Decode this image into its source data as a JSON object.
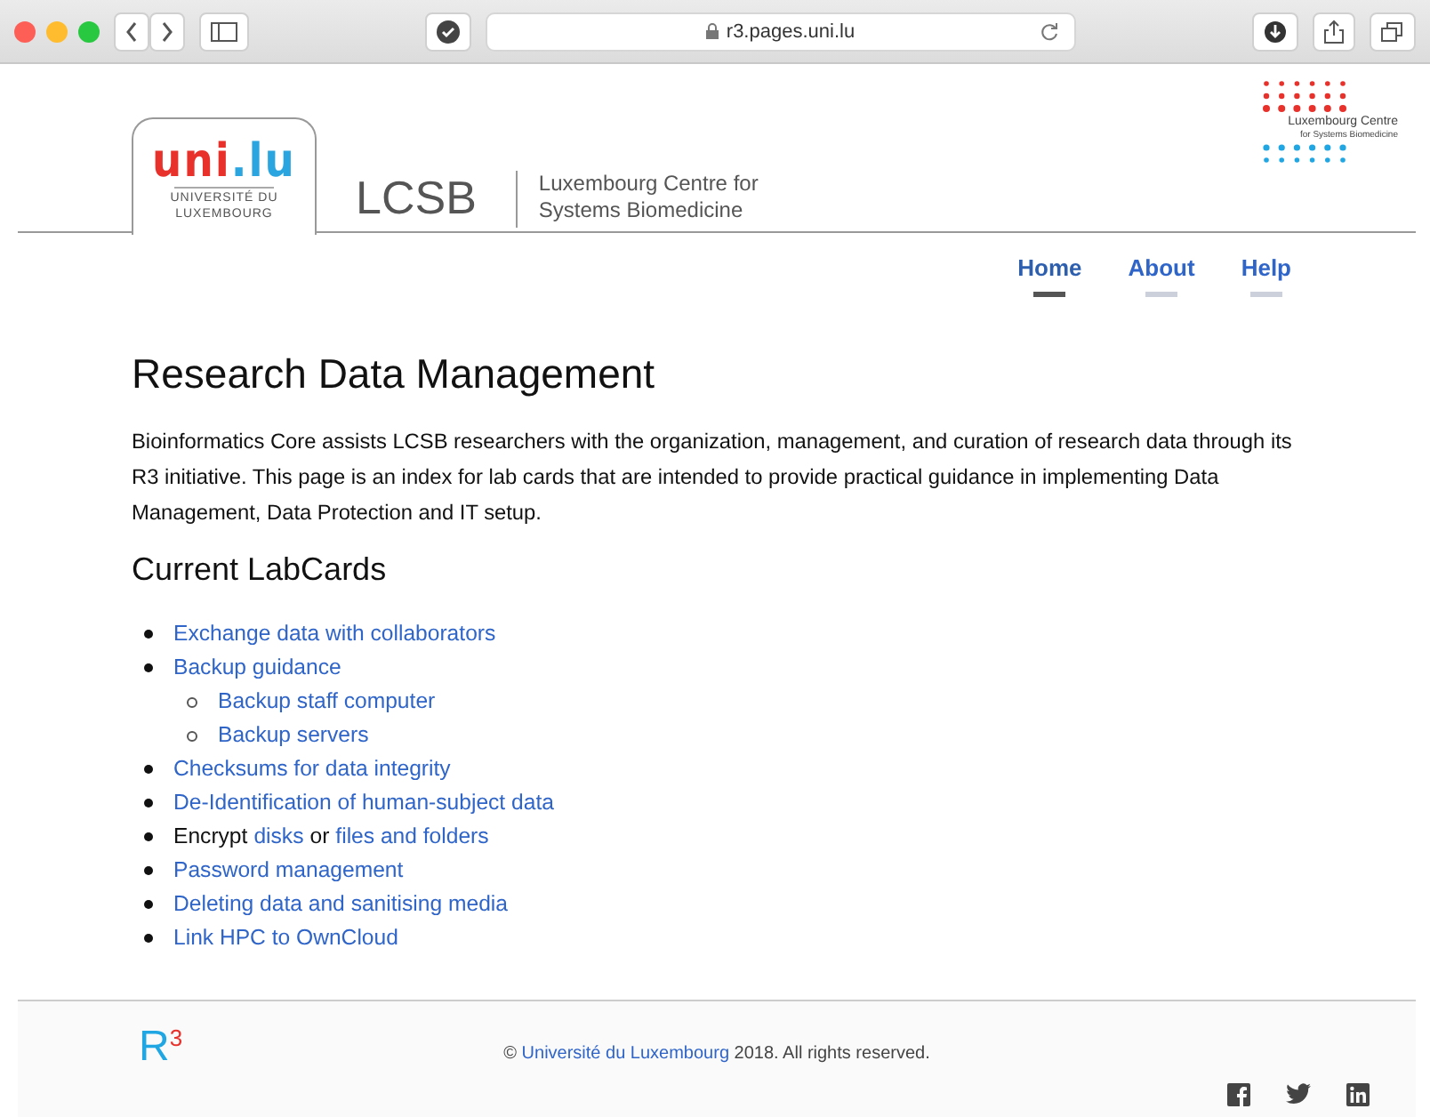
{
  "browser": {
    "url": "r3.pages.uni.lu"
  },
  "header": {
    "uni_logo": {
      "red": "uni",
      "blue": ".lu",
      "line1": "UNIVERSITÉ DU",
      "line2": "LUXEMBOURG"
    },
    "lcsb": "LCSB",
    "centre_name": [
      "Luxembourg Centre for",
      "Systems Biomedicine"
    ],
    "dots_logo": {
      "title": "Luxembourg Centre",
      "subtitle": "for Systems Biomedicine"
    }
  },
  "nav": [
    {
      "label": "Home",
      "selected": true
    },
    {
      "label": "About",
      "selected": false
    },
    {
      "label": "Help",
      "selected": false
    }
  ],
  "title": "Research Data Management",
  "intro": "Bioinformatics Core assists LCSB researchers with the organization, management, and curation of research data through its R3 initiative. This page is an index for lab cards that are intended to provide practical guidance in implementing Data Management, Data Protection and IT setup.",
  "section_title": "Current LabCards",
  "labcards": [
    {
      "parts": [
        {
          "kind": "link",
          "text": "Exchange data with collaborators"
        }
      ]
    },
    {
      "parts": [
        {
          "kind": "link",
          "text": "Backup guidance"
        }
      ],
      "children": [
        {
          "parts": [
            {
              "kind": "link",
              "text": "Backup staff computer"
            }
          ]
        },
        {
          "parts": [
            {
              "kind": "link",
              "text": "Backup servers"
            }
          ]
        }
      ]
    },
    {
      "parts": [
        {
          "kind": "link",
          "text": "Checksums for data integrity"
        }
      ]
    },
    {
      "parts": [
        {
          "kind": "link",
          "text": "De-Identification of human-subject data"
        }
      ]
    },
    {
      "parts": [
        {
          "kind": "text",
          "text": "Encrypt"
        },
        {
          "kind": "link",
          "text": "disks"
        },
        {
          "kind": "text",
          "text": "or"
        },
        {
          "kind": "link",
          "text": "files and folders"
        }
      ]
    },
    {
      "parts": [
        {
          "kind": "link",
          "text": "Password management"
        }
      ]
    },
    {
      "parts": [
        {
          "kind": "link",
          "text": "Deleting data and sanitising media"
        }
      ]
    },
    {
      "parts": [
        {
          "kind": "link",
          "text": "Link HPC to OwnCloud"
        }
      ]
    }
  ],
  "footer": {
    "logo": {
      "letter": "R",
      "sup": "3"
    },
    "copyright": {
      "before": "©",
      "link": "Université du Luxembourg",
      "after": "2018. All rights reserved."
    }
  }
}
